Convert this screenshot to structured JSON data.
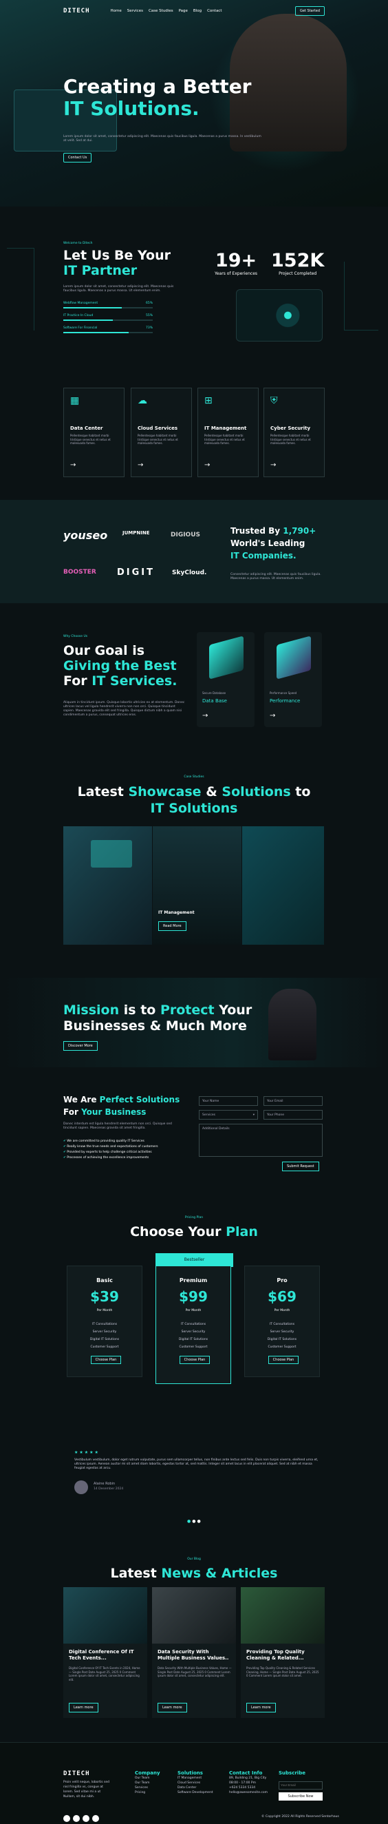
{
  "brand": {
    "logo": "DITECH",
    "accent": "#2ee6d6",
    "bg": "#0b1214"
  },
  "nav": {
    "items": [
      "Home",
      "Services",
      "Case Studies",
      "Page",
      "Blog",
      "Contact"
    ],
    "cta": "Get Started"
  },
  "hero": {
    "line1": "Creating a Better",
    "line2": "IT Solutions.",
    "sub": "Lorem ipsum dolor sit amet, consectetur adipiscing elit. Maecenas quis faucibus ligula. Maecenas a purus massa. In vestibulum at velit. Sed at dui.",
    "cta": "Contact Us"
  },
  "about": {
    "tag": "Welcome to Ditech",
    "title1": "Let Us Be Your",
    "title2": "IT Partner",
    "desc": "Lorem ipsum dolor sit amet, consectetur adipiscing elit. Maecenas quis faucibus ligula. Maecenas a purus massa. Ut elementum enim.",
    "skills": [
      {
        "label": "Webflow Management",
        "pct": "65%",
        "value": 0.65
      },
      {
        "label": "IT Practice In Cloud",
        "pct": "55%",
        "value": 0.55
      },
      {
        "label": "Software For Financial",
        "pct": "73%",
        "value": 0.73
      }
    ],
    "stats": [
      {
        "num": "19+",
        "label": "Years of Experiences"
      },
      {
        "num": "152K",
        "label": "Project Completed"
      }
    ]
  },
  "services": [
    {
      "title": "Data Center",
      "desc": "Pellentesque habitant morbi tristique senectus et netus et malesuada fames."
    },
    {
      "title": "Cloud Services",
      "desc": "Pellentesque habitant morbi tristique senectus et netus et malesuada fames."
    },
    {
      "title": "IT Management",
      "desc": "Pellentesque habitant morbi tristique senectus et netus et malesuada fames."
    },
    {
      "title": "Cyber Security",
      "desc": "Pellentesque habitant morbi tristique senectus et netus et malesuada fames."
    }
  ],
  "clients": {
    "logos": [
      "youseo",
      "JUMPNINE",
      "DIGIOUS",
      "BOOSTER",
      "DIGIT",
      "SkyCloud."
    ],
    "t1": "Trusted By ",
    "num": "1,790+",
    "t2": "World's Leading",
    "t3": "IT Companies.",
    "desc": "Consectetur adipiscing elit. Maecenas quis faucibus ligula. Maecenas a purus massa. Ut elementum enim."
  },
  "goal": {
    "tag": "Why Choose Us",
    "l1": "Our Goal is",
    "l2": "Giving the Best",
    "l3a": "For ",
    "l3b": "IT Services.",
    "desc": "Aliquam in tincidunt ipsum. Quisque lobortis ultricies ex at elementum. Donec ultrices lacus vel ligula hendrerit viverra non non orci. Quisque tincidunt sapien. Maecenas gravida elit sed fringilla. Quisque dictum nibh a quam nisi condimentum a purus, consequat ultrices eros.",
    "cards": [
      {
        "small": "Secure Database",
        "title": "Data Base"
      },
      {
        "small": "Performance Speed",
        "title": "Performance"
      }
    ]
  },
  "showcase": {
    "tag": "Case Studies",
    "t1": "Latest ",
    "t2": "Showcase",
    "t3": " & ",
    "t4": "Solutions",
    "t5": " to",
    "t6": "IT Solutions",
    "card_title": "IT Management",
    "card_btn": "Read More"
  },
  "mission": {
    "w1": "Mission",
    "w2": " is to ",
    "w3": "Protect",
    "w4": " Your",
    "l2": "Businesses & Much More",
    "btn": "Discover More"
  },
  "contact": {
    "l1a": "We Are ",
    "l1b": "Perfect Solutions",
    "l2a": "For ",
    "l2b": "Your Business",
    "desc": "Donec interdum est ligula hendrerit elementum non orci. Quisque sed tincidunt sapien. Maecenas gravida sit amet fringilla.",
    "checks": [
      "We are committed to providing quality IT Services",
      "Really know the true needs and expectations of customers",
      "Provided by experts to help challenge critical activities",
      "Processes of achieving the excellence improvements"
    ],
    "fields": [
      "Your Name",
      "Your Email",
      "Services",
      "Your Phone",
      "Additional Details"
    ],
    "submit": "Submit Request"
  },
  "pricing": {
    "tag": "Pricing Plan",
    "t1": "Choose Your ",
    "t2": "Plan",
    "badge": "Bestseller",
    "plans": [
      {
        "name": "Basic",
        "price": "$39",
        "per": "Per Month",
        "features": [
          "IT Consultations",
          "Server Security",
          "Digital IT Solutions",
          "Customer Support"
        ],
        "btn": "Choose Plan"
      },
      {
        "name": "Premium",
        "price": "$99",
        "per": "Per Month",
        "features": [
          "IT Consultations",
          "Server Security",
          "Digital IT Solutions",
          "Customer Support"
        ],
        "btn": "Choose Plan"
      },
      {
        "name": "Pro",
        "price": "$69",
        "per": "Per Month",
        "features": [
          "IT Consultations",
          "Server Security",
          "Digital IT Solutions",
          "Customer Support"
        ],
        "btn": "Choose Plan"
      }
    ]
  },
  "testimonial": {
    "stars": "★★★★★",
    "quote": "Vestibulum vestibulum, dolor eget rutrum vulputate, purus sem ullamcorper tellus, non finibus ante lectus sed felis. Duis non turpis viverra, eleifend urna et, ultrices ipsum. Aenean auctor mi sit amet diam lobortis, egestas tortor at, sed mattis. Integer sit amet lacus in elit placerat aliquet. Sed at nibh et massa feugiat egestas at arcu.",
    "name": "Alaine Robin",
    "date": "14 Desember 2024"
  },
  "news": {
    "tag": "Our Blog",
    "t1": "Latest ",
    "t2": "News & Articles",
    "posts": [
      {
        "title": "Digital Conference Of IT Tech Events...",
        "desc": "Digital Conference Of IT Tech Events in 2024, Home — Single Post Date August 25, 2025 0 Comment Lorem ipsum dolor sit amet, consectetur adipiscing elit.",
        "btn": "Learn more"
      },
      {
        "title": "Data Security With Multiple Business Values..",
        "desc": "Data Security With Multiple Business Values, Home — Single Post Date August 25, 2025 0 Comment Lorem ipsum dolor sit amet, consectetur adipiscing elit.",
        "btn": "Learn more"
      },
      {
        "title": "Providing Top Quality Cleaning & Related...",
        "desc": "Providing Top Quality Cleaning & Related Services Cleaning, Home — Single Post Date August 25, 2025 0 Comment Lorem ipsum dolor sit amet.",
        "btn": "Learn more"
      }
    ]
  },
  "footer": {
    "logo": "DITECH",
    "about": "Proin velit neque, lobortis sed nisl fringilla vs, congue at lorem. Sed vitae mi a ut Nullam, sit dui nibh.",
    "company": {
      "title": "Company",
      "links": [
        "Our Team",
        "Our Team",
        "Services",
        "Pricing"
      ]
    },
    "solutions": {
      "title": "Solutions",
      "links": [
        "IT Management",
        "Cloud Services",
        "Data Center",
        "Software Development"
      ]
    },
    "info": {
      "title": "Contact Info",
      "lines": [
        "89, Building 21, Big City",
        "08:00 - 17:00 Pm",
        "+624 5334 5334",
        "hello@awesomesite.com"
      ]
    },
    "subscribe": {
      "title": "Subscribe",
      "placeholder": "Your Email",
      "btn": "Subscribe Now"
    },
    "copyright": "© Copyright 2022 All Rights Reserved Sentorhaus"
  }
}
